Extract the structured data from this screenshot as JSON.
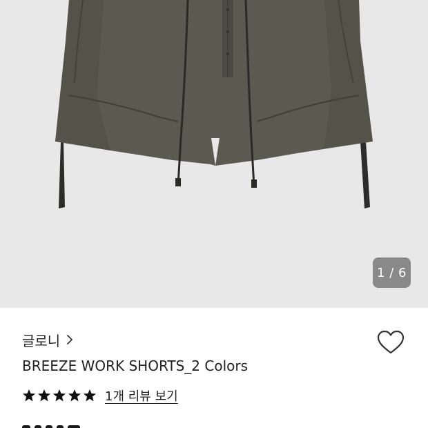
{
  "gallery": {
    "image_alt": "",
    "indicator": "1 / 6"
  },
  "product": {
    "brand": "글로니",
    "title": "BREEZE WORK SHORTS_2 Colors",
    "rating": 5,
    "rating_max": 5,
    "review_link": "1개 리뷰 보기",
    "wishlisted": false
  },
  "icons": {
    "brand_chevron": "chevron-right-icon",
    "wishlist": "heart-outline-icon",
    "star": "star-filled-icon"
  },
  "colors": {
    "gallery_background": "#e8e8e8",
    "shorts_fabric": "#5a5a50",
    "indicator_background": "#6e6e6e",
    "text": "#222222"
  }
}
